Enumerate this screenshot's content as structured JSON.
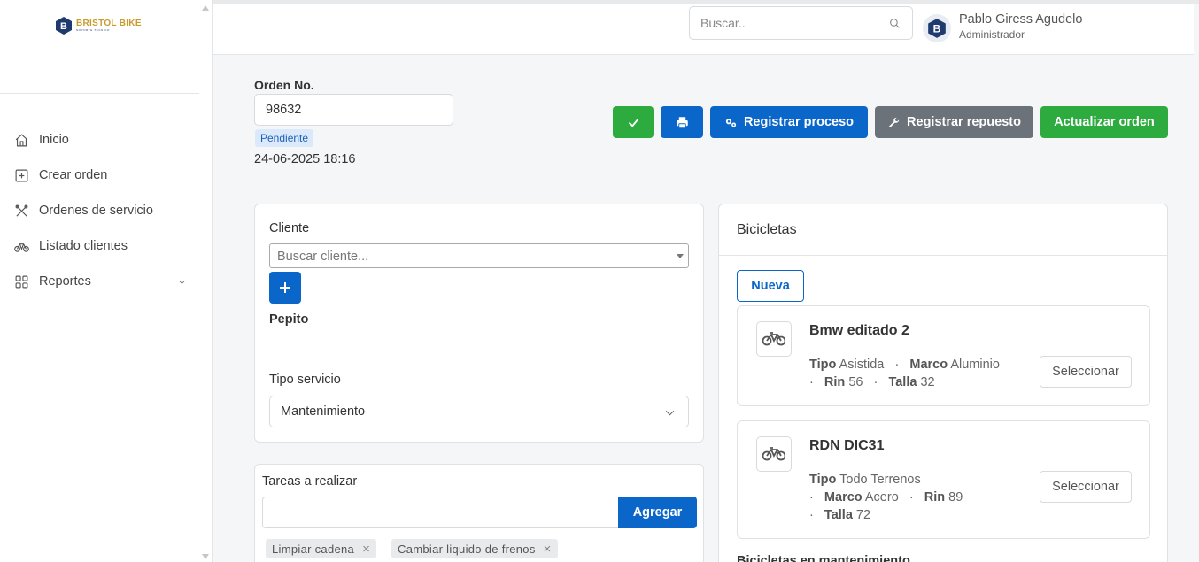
{
  "brand": {
    "name": "BRISTOL BIKE",
    "tagline": "SOPORTE TECNICO",
    "badge_letter": "B"
  },
  "sidebar": {
    "items": [
      {
        "label": "Inicio",
        "icon": "home-icon"
      },
      {
        "label": "Crear orden",
        "icon": "plus-square-icon"
      },
      {
        "label": "Ordenes de servicio",
        "icon": "tools-icon"
      },
      {
        "label": "Listado clientes",
        "icon": "bicycle-icon"
      },
      {
        "label": "Reportes",
        "icon": "grid-icon"
      }
    ]
  },
  "topbar": {
    "search_placeholder": "Buscar..",
    "user_name": "Pablo Giress Agudelo",
    "user_role": "Administrador"
  },
  "order": {
    "label": "Orden No.",
    "number": "98632",
    "status": "Pendiente",
    "date": "24-06-2025 18:16"
  },
  "actions": {
    "register_process": "Registrar proceso",
    "register_part": "Registrar repuesto",
    "update_order": "Actualizar orden"
  },
  "client_card": {
    "client_label": "Cliente",
    "client_placeholder": "Buscar cliente...",
    "client_name": "Pepito",
    "service_label": "Tipo servicio",
    "service_value": "Mantenimiento"
  },
  "tasks_card": {
    "title": "Tareas a realizar",
    "add_label": "Agregar",
    "tasks": [
      "Limpiar cadena",
      "Cambiar liquido de frenos"
    ]
  },
  "bikes_card": {
    "title": "Bicicletas",
    "new_label": "Nueva",
    "select_label": "Seleccionar",
    "bikes": [
      {
        "name": "Bmw editado 2",
        "tipo": "Asistida",
        "marco": "Aluminio",
        "rin": "56",
        "talla": "32"
      },
      {
        "name": "RDN DIC31",
        "tipo": "Todo Terrenos",
        "marco": "Acero",
        "rin": "89",
        "talla": "72"
      }
    ],
    "attr_labels": {
      "tipo": "Tipo",
      "marco": "Marco",
      "rin": "Rin",
      "talla": "Talla"
    },
    "maintenance_title": "Bicicletas en mantenimiento"
  },
  "colors": {
    "primary": "#0a66c9",
    "success": "#2dab3f",
    "secondary": "#6c727a",
    "brand_gold": "#c89b2d",
    "brand_navy": "#1f3a6e"
  }
}
